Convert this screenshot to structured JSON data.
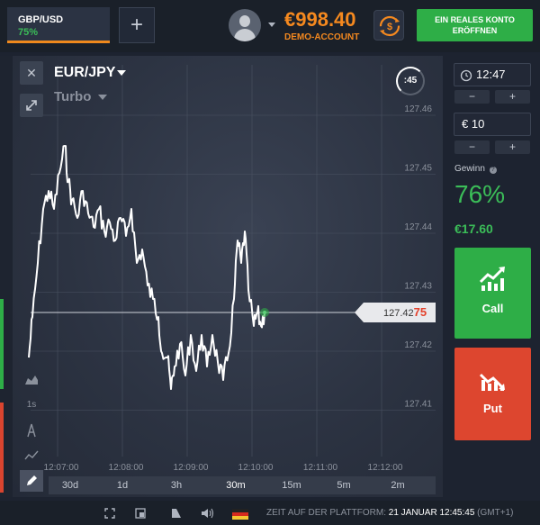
{
  "topbar": {
    "asset_tab": {
      "name": "GBP/USD",
      "percent": "75%"
    },
    "add_tab_label": "+",
    "balance": "€998.40",
    "account_type": "DEMO-ACCOUNT",
    "open_account_label": "EIN REALES KONTO ERÖFFNEN"
  },
  "chart": {
    "pair": "EUR/JPY",
    "mode": "Turbo",
    "countdown": ":45",
    "current_price_main": "127.42",
    "current_price_highlight": "75",
    "y_ticks": [
      "127.46",
      "127.45",
      "127.44",
      "127.43",
      "127.42",
      "127.41"
    ],
    "x_ticks": [
      "12:07:00",
      "12:08:00",
      "12:09:00",
      "12:10:00",
      "12:11:00",
      "12:12:00"
    ],
    "tools": [
      "area-chart",
      "1s",
      "compass",
      "trend",
      "pencil"
    ],
    "tool_1s_label": "1s",
    "periods": [
      "30d",
      "1d",
      "3h",
      "30m",
      "15m",
      "5m",
      "2m"
    ],
    "active_period": "30m",
    "line_color": "#ffffff"
  },
  "right_panel": {
    "time_value": "12:47",
    "amount_value": "€ 10",
    "stepper_minus": "−",
    "stepper_plus": "+",
    "profit_label": "Gewinn",
    "profit_percent": "76%",
    "profit_amount": "€17.60",
    "call_label": "Call",
    "put_label": "Put"
  },
  "footer": {
    "platform_time_label": "ZEIT AUF DER PLATTFORM:",
    "platform_time_value": "21 JANUAR 12:45:45",
    "timezone": "(GMT+1)"
  },
  "colors": {
    "accent_orange": "#f5891f",
    "call_green": "#2eae47",
    "put_red": "#dd462f",
    "profit_green": "#3bbd58"
  }
}
